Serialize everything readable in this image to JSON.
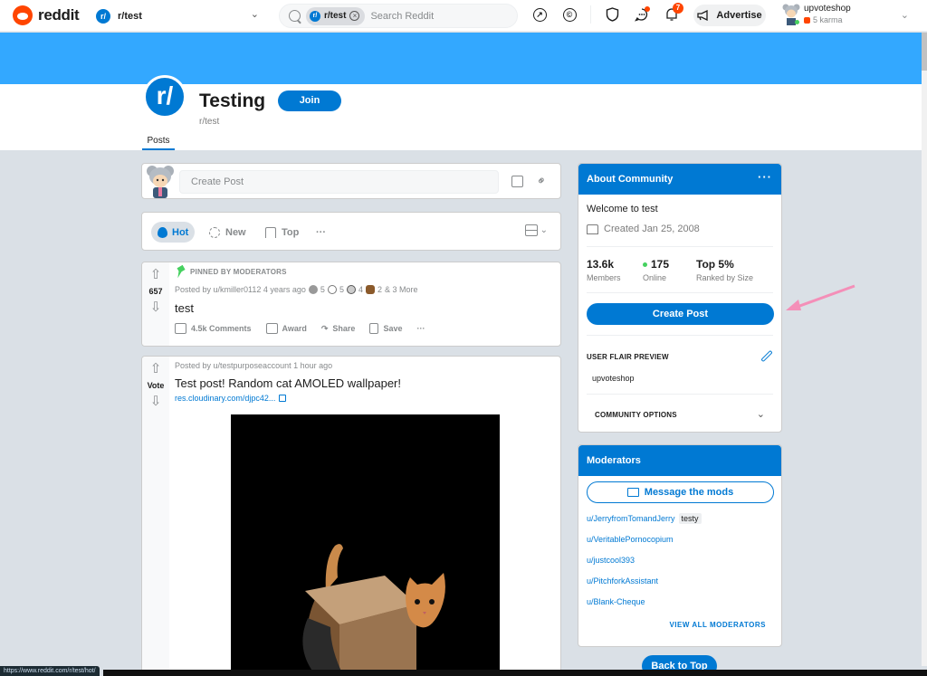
{
  "header": {
    "brand": "reddit",
    "community_selector": "r/test",
    "search_chip": "r/test",
    "search_placeholder": "Search Reddit",
    "notification_count": "7",
    "advertise_label": "Advertise",
    "username": "upvoteshop",
    "karma": "5 karma",
    "icons": [
      "popular-icon",
      "coins-icon",
      "mod-shield-icon",
      "chat-icon",
      "bell-icon",
      "plus-icon",
      "megaphone-icon"
    ]
  },
  "subreddit": {
    "icon_text": "r/",
    "title": "Testing",
    "name": "r/test",
    "join_label": "Join",
    "tab": "Posts"
  },
  "feed": {
    "create_post_placeholder": "Create Post",
    "sort": {
      "hot": "Hot",
      "new": "New",
      "top": "Top",
      "more": "···"
    },
    "posts": [
      {
        "pinned_label": "PINNED BY MODERATORS",
        "score": "657",
        "author_line": "Posted by u/kmiller0112 4 years ago",
        "awards": [
          "5",
          "5",
          "4",
          "2"
        ],
        "awards_more": "& 3 More",
        "title": "test",
        "comments": "4.5k Comments",
        "award_label": "Award",
        "share_label": "Share",
        "save_label": "Save",
        "more": "···"
      },
      {
        "score": "Vote",
        "author_line": "Posted by u/testpurposeaccount 1 hour ago",
        "title": "Test post! Random cat AMOLED wallpaper!",
        "link": "res.cloudinary.com/djpc42..."
      }
    ]
  },
  "sidebar": {
    "about": {
      "title": "About Community",
      "more": "···",
      "description": "Welcome to test",
      "created": "Created Jan 25, 2008",
      "members_value": "13.6k",
      "members_label": "Members",
      "online_value": "175",
      "online_label": "Online",
      "rank_value": "Top 5%",
      "rank_label": "Ranked by Size",
      "create_post_label": "Create Post",
      "flair_preview_label": "USER FLAIR PREVIEW",
      "flair_value": "upvoteshop",
      "community_options_label": "COMMUNITY OPTIONS"
    },
    "moderators": {
      "title": "Moderators",
      "message_label": "Message the mods",
      "list": [
        {
          "name": "u/JerryfromTomandJerry",
          "flair": "testy"
        },
        {
          "name": "u/VeritablePornocopium",
          "flair": ""
        },
        {
          "name": "u/justcool393",
          "flair": ""
        },
        {
          "name": "u/PitchforkAssistant",
          "flair": ""
        },
        {
          "name": "u/Blank-Cheque",
          "flair": ""
        }
      ],
      "view_all_label": "VIEW ALL MODERATORS"
    },
    "back_to_top_label": "Back to Top"
  },
  "status_bar": {
    "url": "https://www.reddit.com/r/test/hot/"
  },
  "colors": {
    "brand": "#ff4500",
    "primary": "#0079d3",
    "banner": "#33a8ff",
    "annotation_arrow": "#f48fb8"
  }
}
